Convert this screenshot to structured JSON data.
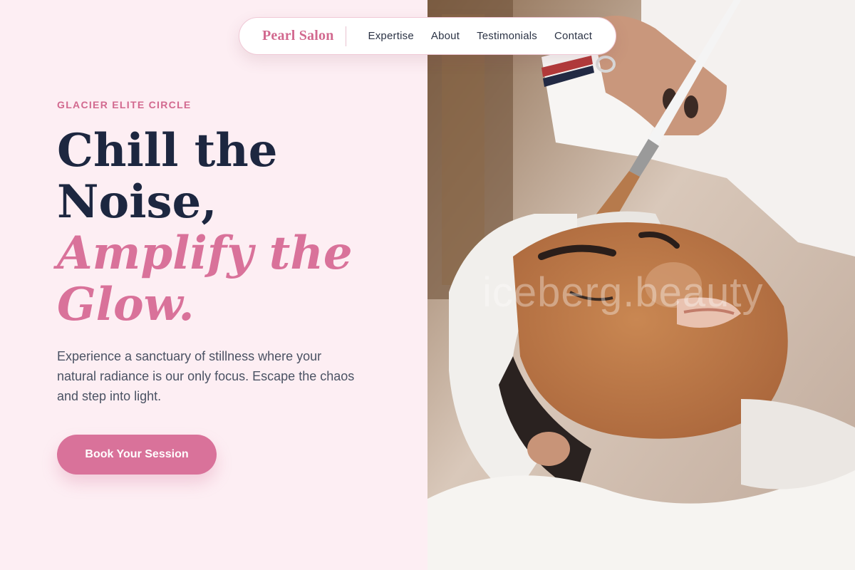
{
  "nav": {
    "brand": "Pearl Salon",
    "links": [
      "Expertise",
      "About",
      "Testimonials",
      "Contact"
    ]
  },
  "hero": {
    "eyebrow": "GLACIER ELITE CIRCLE",
    "headline_lines": [
      "Chill the",
      "Noise,"
    ],
    "accent_lines": [
      "Amplify the",
      "Glow."
    ],
    "body": "Experience a sanctuary of stillness where your natural radiance is our only focus. Escape the chaos and step into light.",
    "cta_label": "Book Your Session"
  },
  "image": {
    "watermark": "iceberg.beauty"
  },
  "colors": {
    "accent": "#d9729a",
    "brand": "#d2698f",
    "heading": "#1d2740",
    "background": "#fdeef3"
  }
}
